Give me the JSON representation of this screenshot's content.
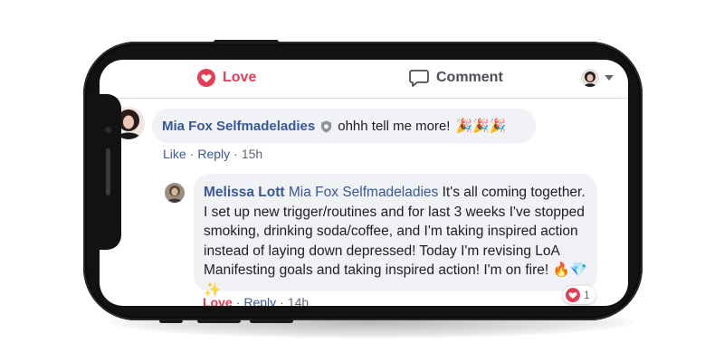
{
  "actions": {
    "love_label": "Love",
    "comment_label": "Comment"
  },
  "comment1": {
    "author": "Mia Fox Selfmadeladies",
    "text": "ohhh tell me more!",
    "emoji": "🎉🎉🎉",
    "like_label": "Like",
    "reply_label": "Reply",
    "time": "15h"
  },
  "comment2": {
    "author": "Melissa Lott",
    "mention": "Mia Fox Selfmadeladies",
    "text": "It's all coming together. I set up new trigger/routines and for last 3 weeks I've stopped smoking, drinking soda/coffee, and I'm taking inspired action instead of laying down depressed! Today I'm revising LoA Manifesting goals and taking inspired action! I'm on fire!",
    "emoji": "🔥💎✨",
    "love_label": "Love",
    "reply_label": "Reply",
    "time": "14h",
    "reaction_count": "1"
  },
  "colors": {
    "love_red": "#e23e57",
    "link_blue": "#385898",
    "bubble_bg": "#f0f2f5"
  }
}
